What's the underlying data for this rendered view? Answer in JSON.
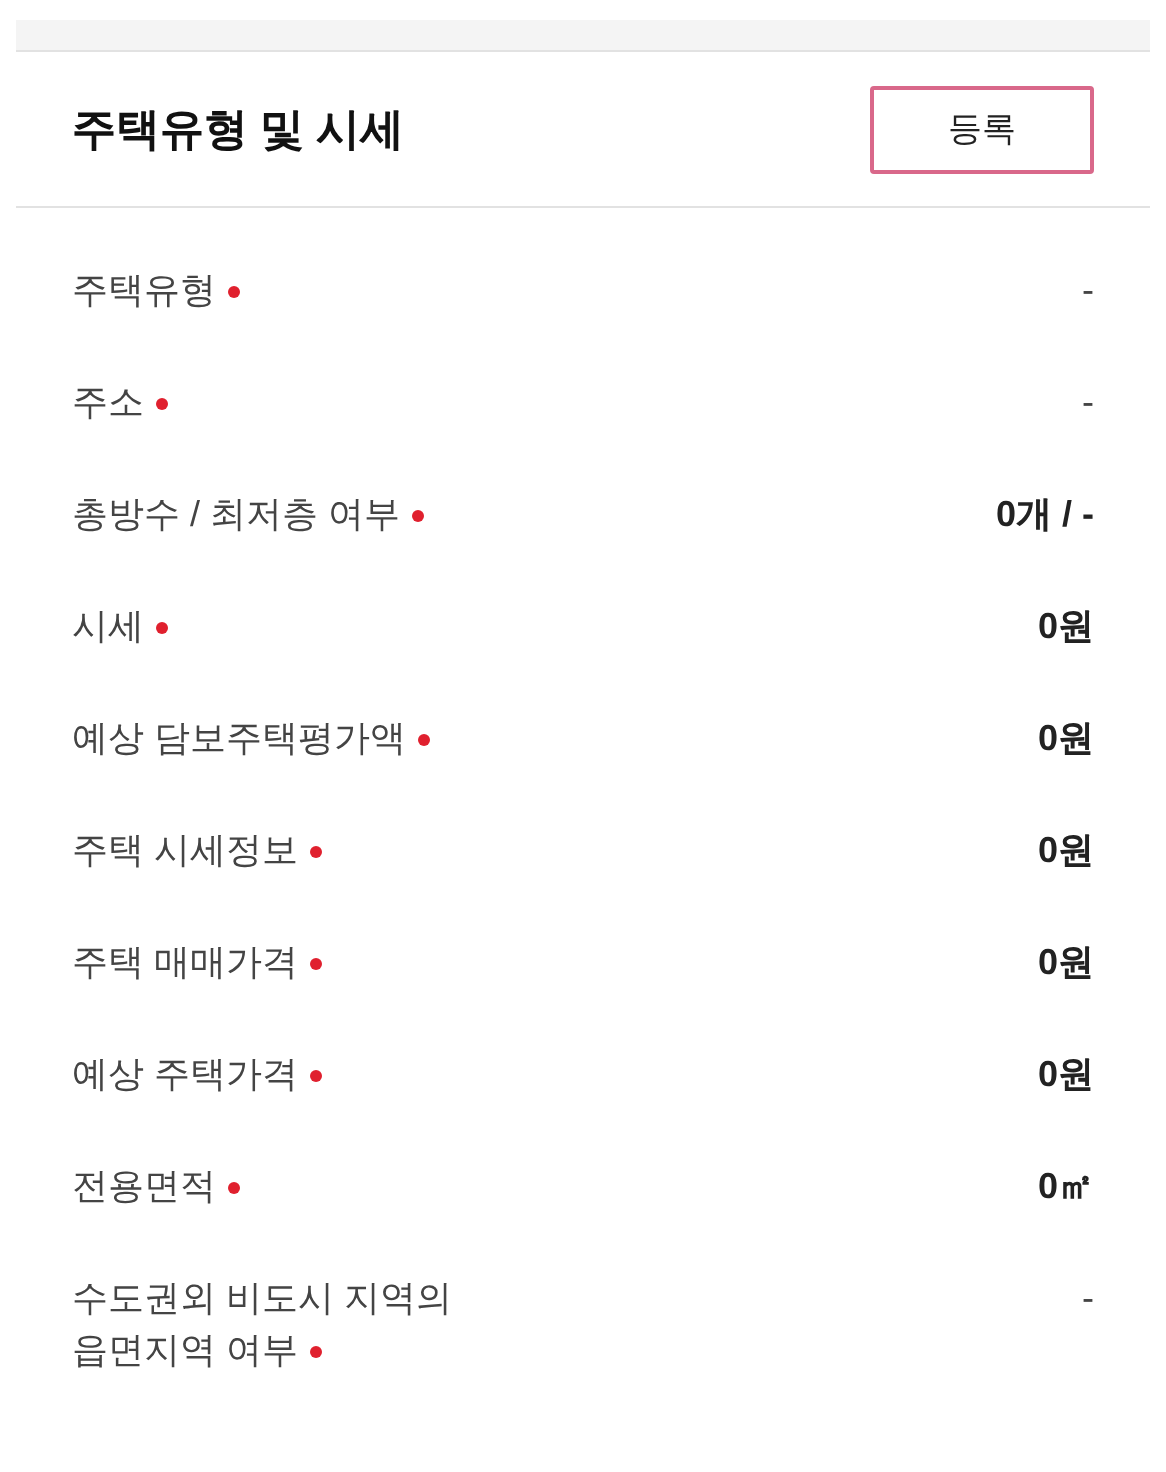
{
  "header": {
    "title": "주택유형 및 시세",
    "button": "등록"
  },
  "rows": [
    {
      "label": "주택유형",
      "required": true,
      "value": "-",
      "kind": "empty"
    },
    {
      "label": "주소",
      "required": true,
      "value": "-",
      "kind": "empty"
    },
    {
      "label": "총방수 / 최저층 여부",
      "required": true,
      "value": "0개 / -",
      "kind": "amount"
    },
    {
      "label": "시세",
      "required": true,
      "value": "0원",
      "kind": "amount"
    },
    {
      "label": "예상 담보주택평가액",
      "required": true,
      "value": "0원",
      "kind": "amount"
    },
    {
      "label": "주택 시세정보",
      "required": true,
      "value": "0원",
      "kind": "amount"
    },
    {
      "label": "주택 매매가격",
      "required": true,
      "value": "0원",
      "kind": "amount"
    },
    {
      "label": "예상 주택가격",
      "required": true,
      "value": "0원",
      "kind": "amount"
    },
    {
      "label": "전용면적",
      "required": true,
      "value": "0㎡",
      "kind": "amount"
    },
    {
      "label": "수도권외 비도시 지역의 읍면지역 여부",
      "required": true,
      "value": "-",
      "kind": "empty"
    }
  ]
}
